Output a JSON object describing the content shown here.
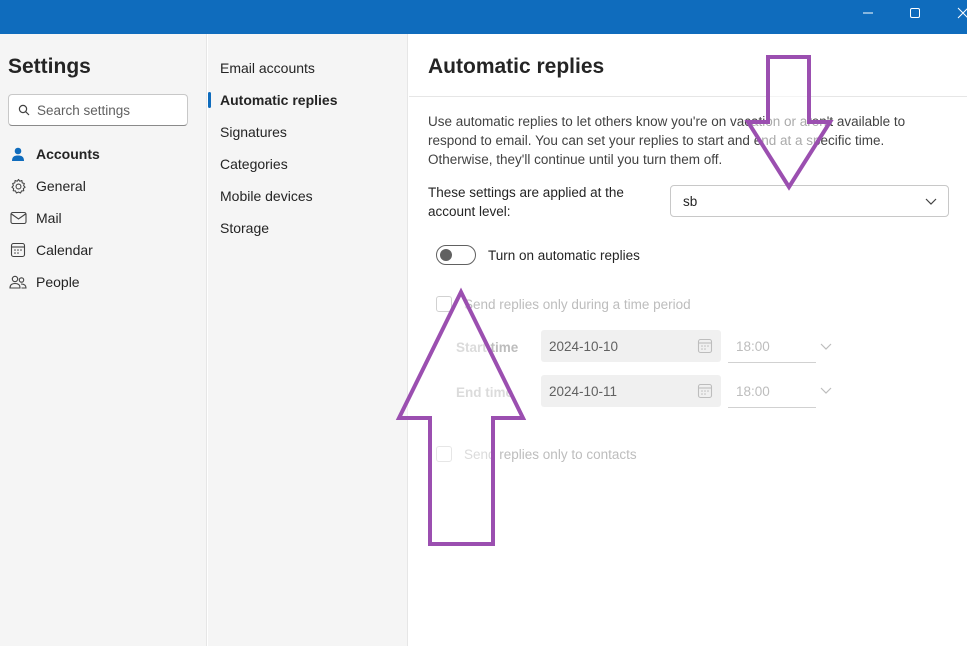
{
  "window": {
    "minimize_icon": "minimize-icon",
    "maximize_icon": "maximize-icon",
    "close_icon": "close-icon"
  },
  "leftnav": {
    "title": "Settings",
    "search_placeholder": "Search settings",
    "items": [
      {
        "label": "Accounts",
        "icon": "person-icon",
        "active": true
      },
      {
        "label": "General",
        "icon": "gear-icon",
        "active": false
      },
      {
        "label": "Mail",
        "icon": "mail-icon",
        "active": false
      },
      {
        "label": "Calendar",
        "icon": "calendar-icon",
        "active": false
      },
      {
        "label": "People",
        "icon": "people-icon",
        "active": false
      }
    ]
  },
  "subnav": {
    "items": [
      {
        "label": "Email accounts",
        "active": false
      },
      {
        "label": "Automatic replies",
        "active": true
      },
      {
        "label": "Signatures",
        "active": false
      },
      {
        "label": "Categories",
        "active": false
      },
      {
        "label": "Mobile devices",
        "active": false
      },
      {
        "label": "Storage",
        "active": false
      }
    ]
  },
  "main": {
    "title": "Automatic replies",
    "description": "Use automatic replies to let others know you're on vacation or aren't available to respond to email. You can set your replies to start and end at a specific time. Otherwise, they'll continue until you turn them off.",
    "applied_label": "These settings are applied at the account level:",
    "account_value": "sb",
    "toggle_label": "Turn on automatic replies",
    "toggle_on": false,
    "time_period_label": "Send replies only during a time period",
    "start_time_label": "Start time",
    "end_time_label": "End time",
    "start_date": "2024-10-10",
    "start_time": "18:00",
    "end_date": "2024-10-11",
    "end_time": "18:00",
    "contacts_label": "Send replies only to contacts"
  },
  "colors": {
    "titlebar": "#0f6cbd",
    "accent": "#0f6cbd",
    "annotation_arrow": "#9b4fb0"
  }
}
